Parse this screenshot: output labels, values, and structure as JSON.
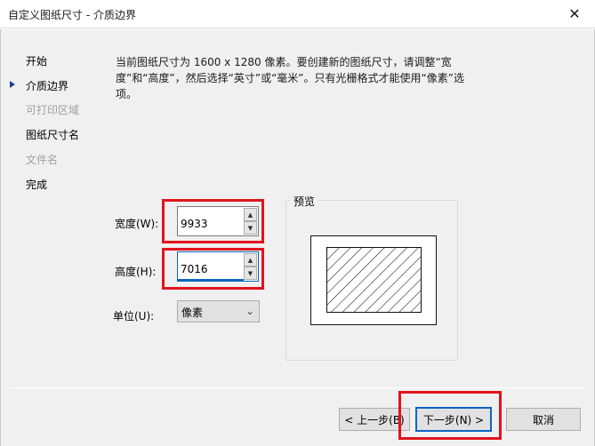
{
  "window": {
    "title": "自定义图纸尺寸 - 介质边界",
    "close_glyph": "✕"
  },
  "nav": {
    "items": [
      {
        "label": "开始",
        "disabled": false,
        "current": false
      },
      {
        "label": "介质边界",
        "disabled": false,
        "current": true
      },
      {
        "label": "可打印区域",
        "disabled": true,
        "current": false
      },
      {
        "label": "图纸尺寸名",
        "disabled": false,
        "current": false
      },
      {
        "label": "文件名",
        "disabled": true,
        "current": false
      },
      {
        "label": "完成",
        "disabled": false,
        "current": false
      }
    ]
  },
  "description": "当前图纸尺寸为 1600 x 1280 像素。要创建新的图纸尺寸，请调整“宽度”和“高度”，然后选择“英寸”或“毫米”。只有光栅格式才能使用“像素”选项。",
  "width_field": {
    "label": "宽度(W):",
    "value": "9933"
  },
  "height_field": {
    "label": "高度(H):",
    "value": "7016"
  },
  "units_field": {
    "label": "单位(U):",
    "selected": "像素"
  },
  "preview": {
    "title": "预览"
  },
  "buttons": {
    "back": "< 上一步(B)",
    "next": "下一步(N) >",
    "cancel": "取消"
  },
  "colors": {
    "highlight": "#e0141e",
    "accent": "#0a66c2",
    "dialog_bg": "#f0f0f0"
  },
  "icons": {
    "spin_up": "▲",
    "spin_down": "▼",
    "dropdown": "⌄",
    "current_step": "arrow-right"
  }
}
